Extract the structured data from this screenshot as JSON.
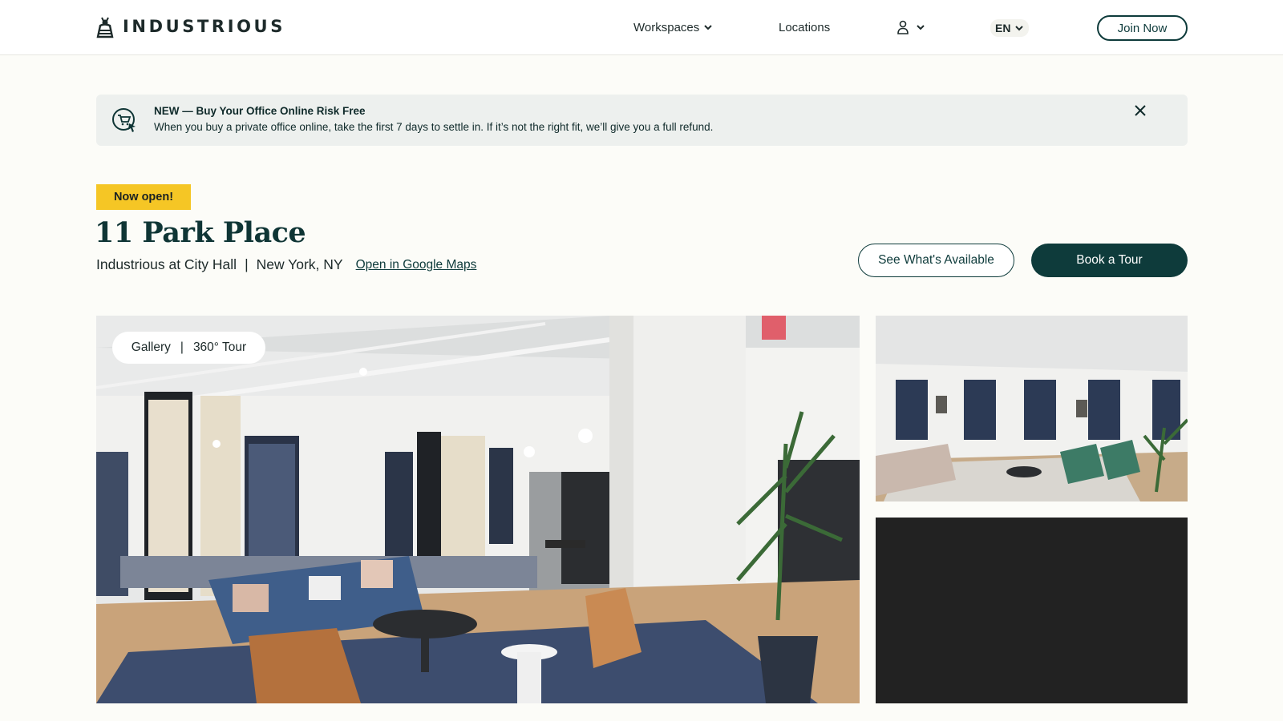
{
  "brand": {
    "name": "INDUSTRIOUS"
  },
  "nav": {
    "workspaces": "Workspaces",
    "locations": "Locations",
    "language": "EN",
    "join": "Join Now"
  },
  "banner": {
    "title": "NEW — Buy Your Office Online Risk Free",
    "text": "When you buy a private office online, take the first 7 days to settle in. If it’s not the right fit, we’ll give you a full refund."
  },
  "location": {
    "badge": "Now open!",
    "title": "11 Park Place",
    "name": "Industrious at City Hall",
    "separator": "|",
    "city": "New York, NY",
    "maps_link": "Open in Google Maps"
  },
  "actions": {
    "see_available": "See What's Available",
    "book_tour": "Book a Tour"
  },
  "gallery": {
    "gallery_label": "Gallery",
    "separator": "|",
    "tour_label": "360° Tour"
  },
  "icons": {
    "logo": "bee-logo-icon",
    "chevron": "chevron-down-icon",
    "account": "user-icon",
    "banner": "shopping-cart-icon",
    "close": "close-icon"
  },
  "colors": {
    "primary": "#0e3b3b",
    "badge": "#f5c625",
    "banner_bg": "#edf0ee",
    "page_bg": "#fcfcf8"
  }
}
